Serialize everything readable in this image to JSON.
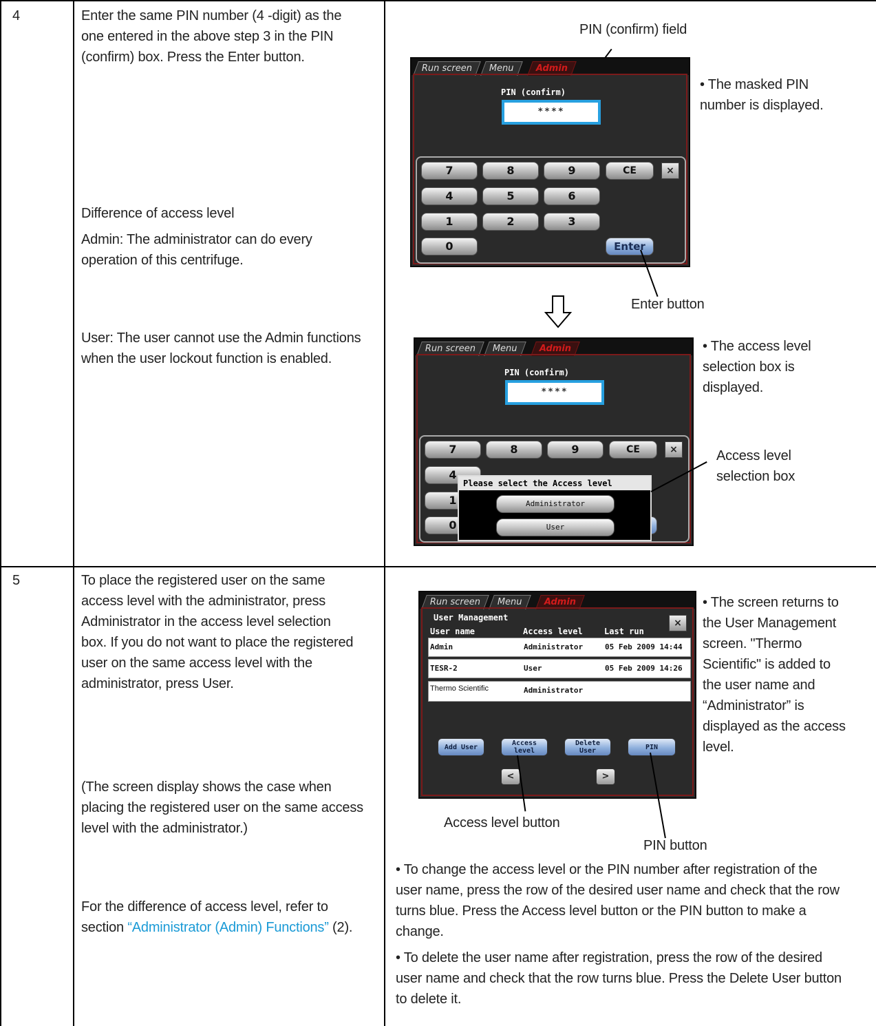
{
  "rows": [
    {
      "step": "4",
      "instruction": [
        "Enter the same PIN number (4 -digit) as the",
        "one entered in the above step 3 in the PIN",
        "(confirm) box. Press the Enter button."
      ],
      "difference_heading": "Difference of access level",
      "admin_note": [
        "Admin: The administrator can do every",
        "operation of this centrifuge."
      ],
      "user_note": [
        "User: The user cannot use the Admin functions",
        "when the user lockout function is enabled."
      ]
    },
    {
      "step": "5",
      "instruction": [
        "To place the registered user on the same",
        "access level with the administrator, press",
        "Administrator in the access level selection",
        "box. If you do not want to place the registered",
        "user on the same access level with the",
        "administrator, press User."
      ],
      "case_note": [
        "(The screen display shows the case when",
        "placing the registered user on the same access",
        "level with the administrator.)"
      ],
      "refer_prefix_1": "For the difference of access level, refer to",
      "refer_prefix_2": "section ",
      "refer_link": "“Administrator (Admin) Functions”",
      "refer_suffix": " (2)."
    }
  ],
  "callouts": {
    "pin_confirm_field": "PIN (confirm) field",
    "masked_pin": [
      "• The masked PIN",
      "number is displayed."
    ],
    "enter_button": "Enter button",
    "access_box_displayed": [
      "• The access level",
      "selection box is",
      "displayed."
    ],
    "access_level_box": [
      "Access level",
      "selection box"
    ],
    "returns": [
      "• The screen returns to",
      "the User Management",
      "screen. \"Thermo",
      "Scientific\" is added to",
      "the user name and",
      "“Administrator” is",
      "displayed as the access",
      "level."
    ],
    "access_level_button": "Access level button",
    "pin_button": "PIN button",
    "change_note": [
      "• To change the access level or the PIN number after registration of the",
      "user name, press the row of the desired user name and check that the row",
      "turns blue. Press the Access level button or the PIN button to make a",
      "change."
    ],
    "delete_note": [
      "• To delete the user name after registration, press the row of the desired",
      "user name and check that the row turns blue. Press the Delete User button",
      "to delete it."
    ]
  },
  "device": {
    "tabs": [
      "Run screen",
      "Menu",
      "Admin"
    ],
    "pin_label": "PIN (confirm)",
    "pin_value": "****",
    "keys": [
      "7",
      "8",
      "9",
      "CE",
      "4",
      "5",
      "6",
      "1",
      "2",
      "3",
      "0",
      "Enter"
    ],
    "close": "×",
    "access_prompt": "Please select the Access level",
    "access_options": [
      "Administrator",
      "User"
    ],
    "um": {
      "title": "User Management",
      "headers": [
        "User name",
        "Access level",
        "Last run"
      ],
      "rows": [
        {
          "name": "Admin",
          "level": "Administrator",
          "last": "05 Feb 2009 14:44"
        },
        {
          "name": "TESR-2",
          "level": "User",
          "last": "05 Feb 2009 14:26"
        },
        {
          "name": "Thermo Scientific",
          "level": "Administrator",
          "last": ""
        }
      ],
      "buttons": [
        "Add User",
        "Access level",
        "Delete User",
        "PIN"
      ],
      "prev": "<",
      "next": ">"
    }
  },
  "colors": {
    "accent_link": "#1a9ad6",
    "pin_box_border": "#27a0e0",
    "admin_tab": "#d21b1b"
  }
}
